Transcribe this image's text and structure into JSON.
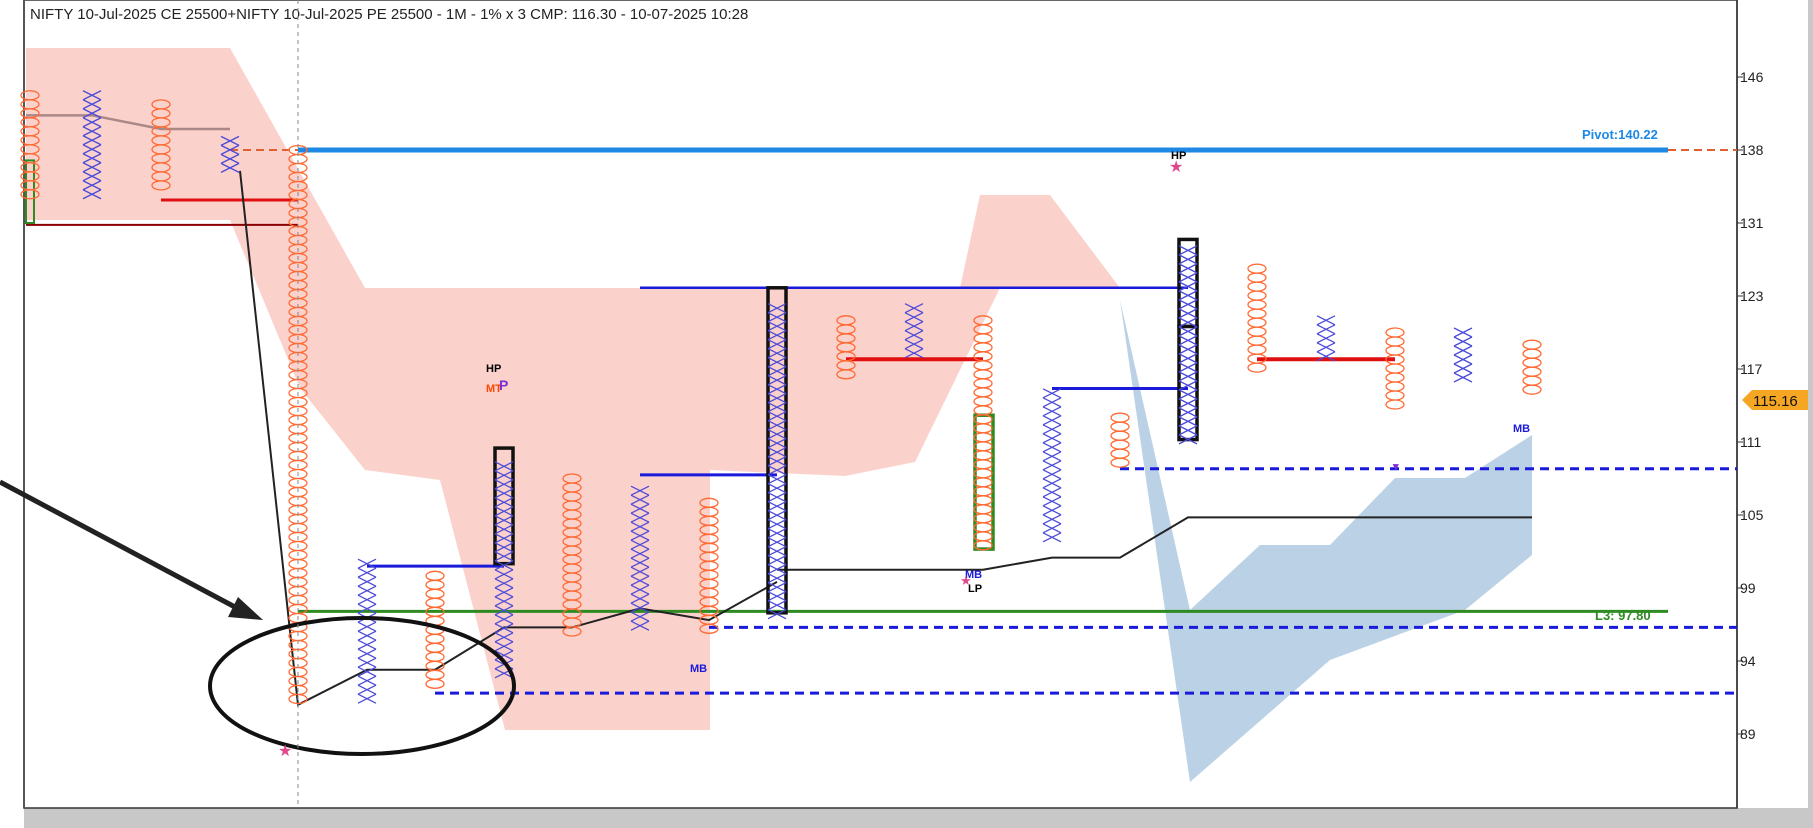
{
  "chart_data": {
    "type": "point-and-figure",
    "title": "NIFTY 10-Jul-2025 CE 25500+NIFTY 10-Jul-2025 PE 25500 - 1M - 1% x 3 CMP: 116.30 - 10-07-2025 10:28",
    "y_ticks": [
      "146",
      "138",
      "131",
      "123",
      "117",
      "111",
      "105",
      "99",
      "94",
      "89"
    ],
    "y_tick_values": [
      146,
      138,
      131,
      123,
      117,
      111,
      105,
      99,
      94,
      89
    ],
    "cmp_marker": {
      "label": "115.16",
      "value": 115.16
    },
    "columns": [
      {
        "type": "O",
        "top": 144,
        "bottom": 133
      },
      {
        "type": "X",
        "top": 144,
        "bottom": 133
      },
      {
        "type": "O",
        "top": 143,
        "bottom": 134
      },
      {
        "type": "X",
        "top": 139,
        "bottom": 136
      },
      {
        "type": "O",
        "top": 138,
        "bottom": 91
      },
      {
        "type": "X",
        "top": 101,
        "bottom": 91
      },
      {
        "type": "O",
        "top": 100,
        "bottom": 92
      },
      {
        "type": "X",
        "top": 109,
        "bottom": 93
      },
      {
        "type": "O",
        "top": 108,
        "bottom": 96
      },
      {
        "type": "X",
        "top": 107,
        "bottom": 96
      },
      {
        "type": "O",
        "top": 106,
        "bottom": 96
      },
      {
        "type": "X",
        "top": 122,
        "bottom": 97
      },
      {
        "type": "O",
        "top": 121,
        "bottom": 116
      },
      {
        "type": "X",
        "top": 122,
        "bottom": 118
      },
      {
        "type": "O",
        "top": 121,
        "bottom": 102
      },
      {
        "type": "X",
        "top": 115,
        "bottom": 103
      },
      {
        "type": "O",
        "top": 113,
        "bottom": 109
      },
      {
        "type": "X",
        "top": 128,
        "bottom": 111
      },
      {
        "type": "O",
        "top": 126,
        "bottom": 117
      },
      {
        "type": "X",
        "top": 121,
        "bottom": 118
      },
      {
        "type": "O",
        "top": 120,
        "bottom": 114
      },
      {
        "type": "X",
        "top": 120,
        "bottom": 116
      },
      {
        "type": "O",
        "top": 119,
        "bottom": 115
      }
    ],
    "horizontal_lines": [
      {
        "label": "Pivot:140.22",
        "color": "#1e88e5",
        "style": "solid",
        "value": 138
      },
      {
        "label": "L3: 97.80",
        "color": "#2e8b22",
        "style": "solid",
        "value": 97.4
      },
      {
        "label": "",
        "color": "#1a1adb",
        "style": "dashed",
        "value": 108.8
      },
      {
        "label": "",
        "color": "#1a1adb",
        "style": "dashed",
        "value": 96.3
      },
      {
        "label": "",
        "color": "#1a1adb",
        "style": "dashed",
        "value": 91.8
      }
    ],
    "text_markers": [
      {
        "text": "HP",
        "color": "#000000"
      },
      {
        "text": "MT",
        "color": "#ff4500"
      },
      {
        "text": "P",
        "color": "#7b2fd6"
      },
      {
        "text": "MB",
        "color": "#1a1adb"
      },
      {
        "text": "MB",
        "color": "#1a1adb"
      },
      {
        "text": "LP",
        "color": "#000000"
      },
      {
        "text": "HP",
        "color": "#000000"
      },
      {
        "text": "MB",
        "color": "#1a1adb"
      }
    ],
    "colors": {
      "o_marks": "#ff6a33",
      "x_marks": "#4a4ad9",
      "bullish_cloud": "#f8a39a",
      "bearish_cloud": "#8eb4d6",
      "pivot_line": "#1e88e5",
      "support_dashed": "#1a1adb",
      "cmp_marker": "#f5a623",
      "resistance_red": "#e01010"
    },
    "grid": false
  }
}
